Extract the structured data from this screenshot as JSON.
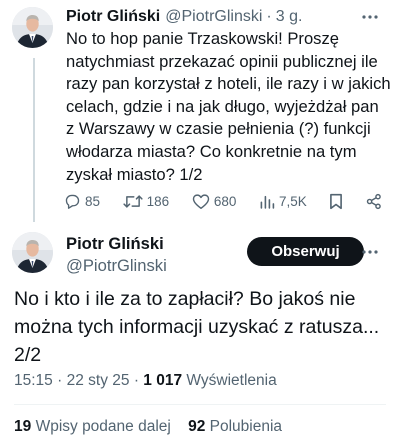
{
  "tweet1": {
    "author_name": "Piotr Gliński",
    "handle": "@PiotrGlinski",
    "separator": "·",
    "time": "3 g.",
    "text": "No to hop panie Trzaskowski! Proszę natychmiast przekazać opinii publicznej ile razy pan korzystał z hoteli, ile razy i w jakich celach, gdzie i na jak długo, wyjeżdżał pan z Warszawy w czasie pełnienia (?) funkcji włodarza miasta? Co konkretnie na tym zyskał miasto? 1/2",
    "replies": "85",
    "retweets": "186",
    "likes": "680",
    "views": "7,5K"
  },
  "tweet2": {
    "author_name": "Piotr Gliński",
    "handle": "@PiotrGlinski",
    "follow_label": "Obserwuj",
    "text": "No i kto i ile za to zapłacił? Bo jakoś nie można tych informacji uzyskać z ratusza... 2/2",
    "time": "15:15",
    "separator": "·",
    "date": "22 sty 25",
    "separator2": "·",
    "views_count": "1 017",
    "views_label": "Wyświetlenia",
    "retweets_count": "19",
    "retweets_label": "Wpisy podane dalej",
    "likes_count": "92",
    "likes_label": "Polubienia"
  },
  "colors": {
    "text": "#0f1419",
    "secondary": "#536471",
    "divider": "#eff3f4",
    "thread_line": "#cfd9de",
    "button_bg": "#0f1419"
  },
  "icons": {
    "reply": "speech-bubble-icon",
    "retweet": "retweet-arrows-icon",
    "like": "heart-icon",
    "views": "bar-chart-icon",
    "bookmark": "bookmark-icon",
    "share": "share-nodes-icon",
    "more": "more-dots-icon"
  }
}
